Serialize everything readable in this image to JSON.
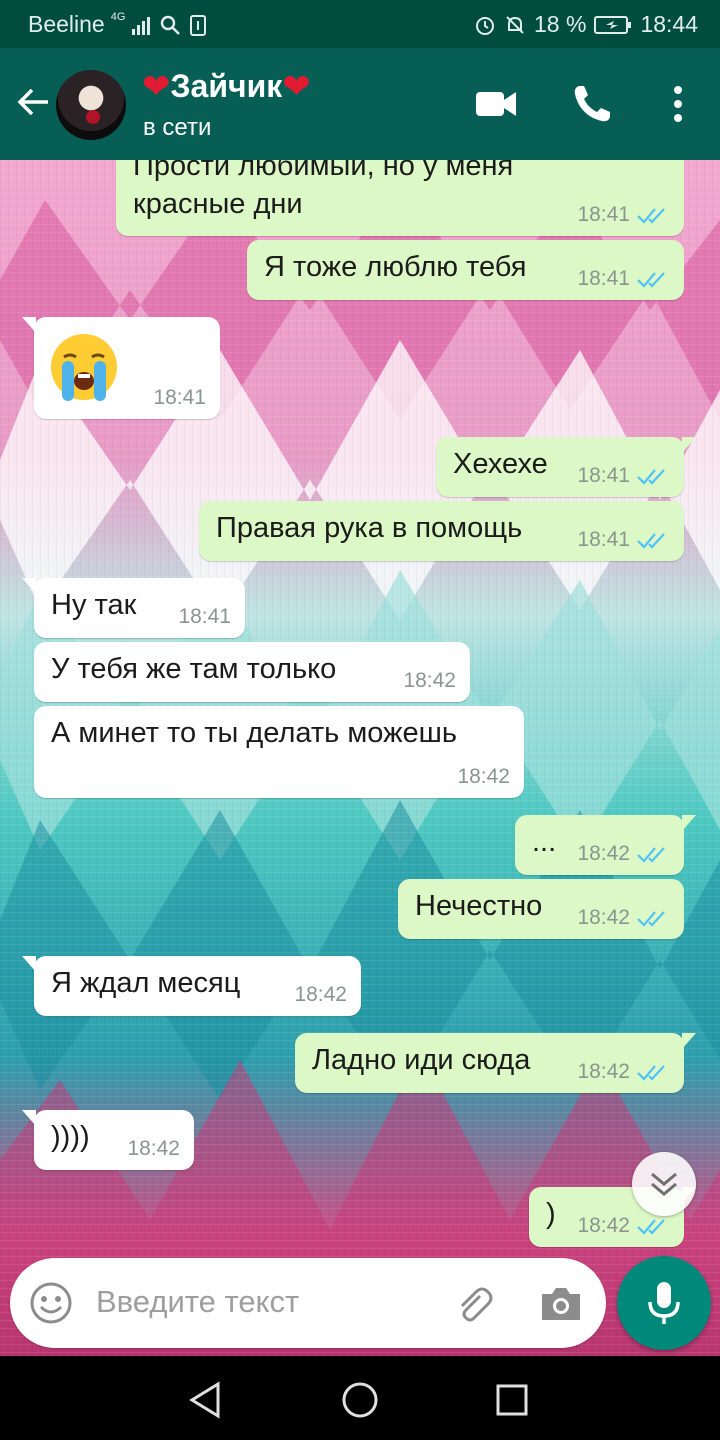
{
  "status_bar": {
    "carrier": "Beeline",
    "network": "4G",
    "battery": "18 %",
    "time": "18:44"
  },
  "contact": {
    "name": "Зайчик",
    "status": "в сети"
  },
  "messages": [
    {
      "direction": "out",
      "line1": "Прости любимый, но у меня",
      "line2": "красные дни",
      "time": "18:41",
      "read": true
    },
    {
      "direction": "out",
      "text": "Я тоже люблю тебя",
      "time": "18:41",
      "read": true
    },
    {
      "direction": "in",
      "text": "😭",
      "time": "18:41"
    },
    {
      "direction": "out",
      "text": "Хехехе",
      "time": "18:41",
      "read": true
    },
    {
      "direction": "out",
      "text": "Правая рука в помощь",
      "time": "18:41",
      "read": true
    },
    {
      "direction": "in",
      "text": "Ну так",
      "time": "18:41"
    },
    {
      "direction": "in",
      "text": "У тебя же там только",
      "time": "18:42"
    },
    {
      "direction": "in",
      "text": "А минет то ты делать можешь",
      "time": "18:42"
    },
    {
      "direction": "out",
      "text": "...",
      "time": "18:42",
      "read": true
    },
    {
      "direction": "out",
      "text": "Нечестно",
      "time": "18:42",
      "read": true
    },
    {
      "direction": "in",
      "text": "Я ждал месяц",
      "time": "18:42"
    },
    {
      "direction": "out",
      "text": "Ладно иди сюда",
      "time": "18:42",
      "read": true
    },
    {
      "direction": "in",
      "text": "))))",
      "time": "18:42"
    },
    {
      "direction": "out",
      "text": ")",
      "time": "18:42",
      "read": true
    }
  ],
  "input": {
    "placeholder": "Введите текст"
  },
  "colors": {
    "header": "#075e54",
    "status_bar": "#004d40",
    "outgoing_bubble": "#dcf8c6",
    "incoming_bubble": "#ffffff",
    "read_ticks": "#4fc3f7",
    "mic_button": "#00897b"
  }
}
